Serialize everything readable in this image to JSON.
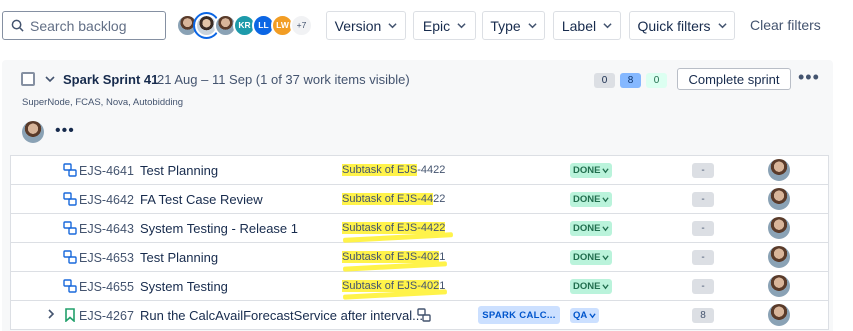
{
  "toolbar": {
    "search_placeholder": "Search backlog",
    "avatars": [
      {
        "initials": "",
        "kind": "photo"
      },
      {
        "initials": "",
        "kind": "photo-selected"
      },
      {
        "initials": "",
        "kind": "photo"
      },
      {
        "initials": "KR",
        "kind": "initials",
        "color": "#1d9aaa"
      },
      {
        "initials": "LL",
        "kind": "initials",
        "color": "#0c66e4"
      },
      {
        "initials": "LW",
        "kind": "initials",
        "color": "#f29d24"
      }
    ],
    "more_avatars": "+7",
    "filters": {
      "version": "Version",
      "epic": "Epic",
      "type": "Type",
      "label": "Label",
      "quick": "Quick filters"
    },
    "clear_filters": "Clear filters"
  },
  "sprint": {
    "name": "Spark Sprint 41",
    "dates": "21 Aug – 11 Sep (1 of 37 work items visible)",
    "counts": {
      "todo": "0",
      "in_progress": "8",
      "done": "0"
    },
    "complete_label": "Complete sprint",
    "goal": "SuperNode, FCAS, Nova, Autobidding"
  },
  "rows": [
    {
      "key": "EJS-4641",
      "summary": "Test Planning",
      "parent_prefix": "Subtask of EJS",
      "parent_suffix": "-4422",
      "status": "DONE",
      "estimate": "-",
      "has_expand": false
    },
    {
      "key": "EJS-4642",
      "summary": "FA Test Case Review",
      "parent_prefix": "Subtask of EJS-44",
      "parent_suffix": "22",
      "status": "DONE",
      "estimate": "-",
      "has_expand": false
    },
    {
      "key": "EJS-4643",
      "summary": "System Testing - Release 1",
      "parent_prefix": "Subtask of EJS-4422",
      "parent_suffix": "",
      "status": "DONE",
      "estimate": "-",
      "has_expand": false
    },
    {
      "key": "EJS-4653",
      "summary": "Test Planning",
      "parent_prefix": "Subtask of EJS-402",
      "parent_suffix": "1",
      "status": "DONE",
      "estimate": "-",
      "has_expand": false
    },
    {
      "key": "EJS-4655",
      "summary": "System Testing",
      "parent_prefix": "Subtask of EJS-402",
      "parent_suffix": "1",
      "status": "DONE",
      "estimate": "-",
      "has_expand": false
    },
    {
      "key": "EJS-4267",
      "summary": "Run the CalcAvailForecastService after interval...",
      "epic": "SPARK CALC...",
      "status": "QA",
      "estimate": "8",
      "has_expand": true
    }
  ],
  "colors": {
    "highlight": "#fff34a",
    "done_bg": "#baf3db",
    "qa_bg": "#cce0ff",
    "epic_bg": "#cce0ff"
  }
}
